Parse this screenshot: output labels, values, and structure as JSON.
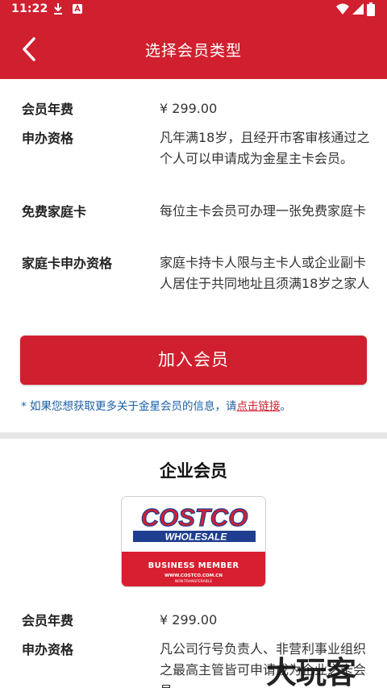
{
  "status_bar": {
    "time": "11:22",
    "icons": [
      "download-icon",
      "notification-icon",
      "wifi-icon",
      "signal-icon",
      "battery-icon"
    ]
  },
  "app_bar": {
    "title": "选择会员类型",
    "back_icon": "back-arrow-icon"
  },
  "gold_member": {
    "rows": [
      {
        "label": "会员年费",
        "value": "¥ 299.00"
      },
      {
        "label": "申办资格",
        "value": "凡年满18岁，且经开市客审核通过之个人可以申请成为金星主卡会员。"
      },
      {
        "label": "免费家庭卡",
        "value": "每位主卡会员可办理一张免费家庭卡"
      },
      {
        "label": "家庭卡申办资格",
        "value": "家庭卡持卡人限与主卡人或企业副卡人居住于共同地址且须满18岁之家人"
      }
    ],
    "join_button": "加入会员",
    "note_prefix": "* 如果您想获取更多关于金星会员的信息，请",
    "note_link": "点击链接",
    "note_suffix": "。"
  },
  "business_member": {
    "section_title": "企业会员",
    "card": {
      "logo_top": "COSTCO",
      "logo_bottom": "WHOLESALE",
      "band_title": "BUSINESS MEMBER",
      "site": "WWW.COSTCO.COM.CN",
      "small_print": "NON-TRANSFERABLE"
    },
    "rows": [
      {
        "label": "会员年费",
        "value": "¥ 299.00"
      },
      {
        "label": "申办资格",
        "value": "凡公司行号负责人、非营利事业组织之最高主管皆可申请成为企业之卡会员"
      }
    ]
  },
  "watermark": "大玩客",
  "colors": {
    "brand_red": "#d01f2e",
    "link_blue": "#1a5fa5",
    "logo_blue": "#1f3e8f"
  }
}
